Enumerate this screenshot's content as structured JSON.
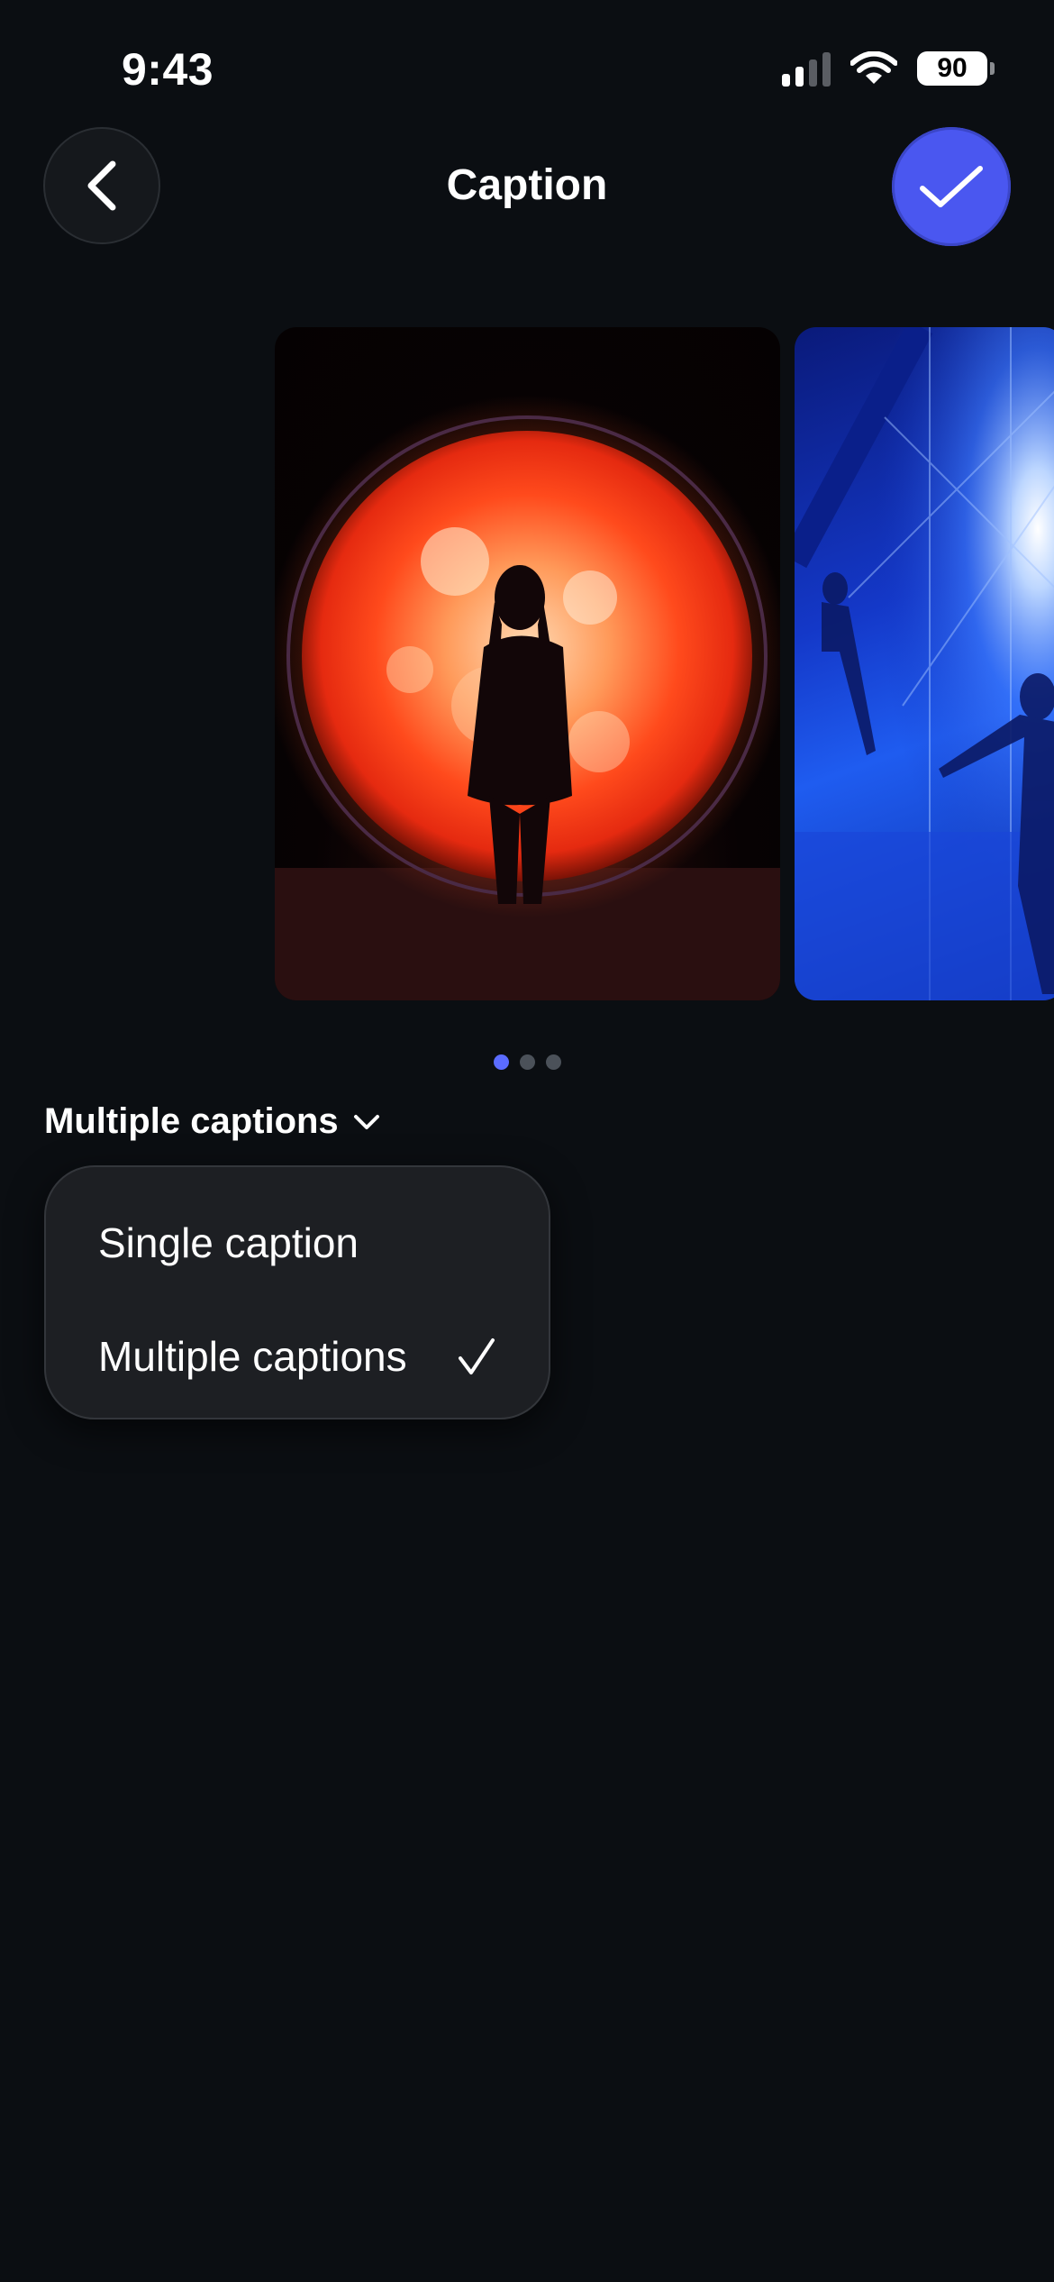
{
  "status_bar": {
    "time": "9:43",
    "battery": "90"
  },
  "header": {
    "title": "Caption",
    "back_icon": "chevron-left-icon",
    "done_icon": "checkmark-icon"
  },
  "colors": {
    "background": "#0b0e12",
    "accent": "#4a57f0",
    "active_dot": "#5b6cff"
  },
  "carousel": {
    "page_count": 3,
    "active_page": 1
  },
  "caption_mode": {
    "selected_label": "Multiple captions",
    "options": [
      {
        "label": "Single caption",
        "selected": false
      },
      {
        "label": "Multiple captions",
        "selected": true
      }
    ]
  }
}
